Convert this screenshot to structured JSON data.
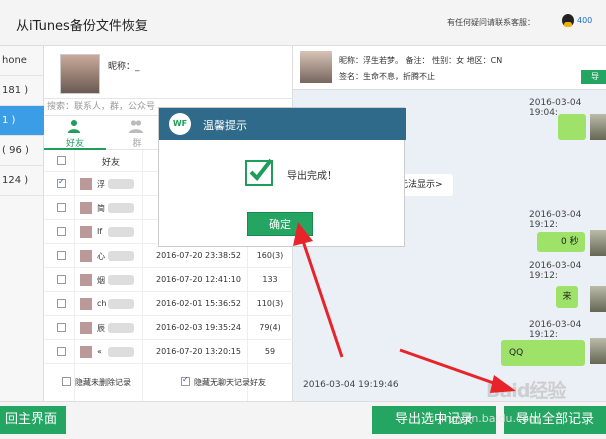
{
  "window": {
    "title": "从iTunes备份文件恢复",
    "help_text": "有任何疑问请联系客服：",
    "help_num": "400"
  },
  "devices": [
    {
      "label": "hone"
    },
    {
      "label": "181 )"
    },
    {
      "label": "1 )"
    },
    {
      "label": "( 96 )"
    },
    {
      "label": "124 )"
    }
  ],
  "account": {
    "nick_label": "昵称：_"
  },
  "search": {
    "placeholder": "搜索：联系人，群，公众号"
  },
  "tabs": {
    "friends": "好友",
    "groups": "群"
  },
  "table": {
    "header_friend": "好友",
    "rows": [
      {
        "name": "浮",
        "date": "",
        "count": "",
        "checked": true
      },
      {
        "name": "简",
        "date": "",
        "count": "",
        "checked": false
      },
      {
        "name": "If",
        "date": "",
        "count": "",
        "checked": false
      },
      {
        "name": "心",
        "date": "2016-07-20 23:38:52",
        "count": "160(3)",
        "checked": false
      },
      {
        "name": "烟",
        "date": "2016-07-20 12:41:10",
        "count": "133",
        "checked": false
      },
      {
        "name": "ch",
        "date": "2016-02-01 15:36:52",
        "count": "110(3)",
        "checked": false
      },
      {
        "name": "辰",
        "date": "2016-02-03 19:35:24",
        "count": "79(4)",
        "checked": false
      },
      {
        "name": "«",
        "date": "2016-07-20 13:20:15",
        "count": "59",
        "checked": false
      }
    ]
  },
  "footer": {
    "hide_deleted": "隐藏未删除记录",
    "hide_no_chat": "隐藏无聊天记录好友"
  },
  "profile": {
    "line1": "昵称：浮生若梦。   备注：             性别：女   地区：CN",
    "line2": "签名：生命不息，折腾不止",
    "button": "导"
  },
  "chat": {
    "ts1": "2016-03-04 19:04:",
    "ts2": "2016-03-04 19:12:",
    "ts3": "2016-03-04 19:12:",
    "ts4": "2016-03-04 19:12:",
    "ts5": "2016-03-04 19:19:46",
    "notice": "无法显示>",
    "voice": "0 秒",
    "msg_lai": "来",
    "msg_q": "QQ"
  },
  "dialog": {
    "logo": "WF",
    "title": "温馨提示",
    "message": "导出完成！",
    "ok": "确定"
  },
  "bottom": {
    "back": "回主界面",
    "export_sel": "导出选中记录",
    "export_all": "导出全部记录"
  },
  "watermark": {
    "brand": "Baid经验",
    "url": "jingyan.baidu.com"
  },
  "colors": {
    "accent": "#24a561",
    "selected": "#3a9de6",
    "header": "#2f6a8a",
    "bubble": "#9ee26a",
    "arrow": "#e8242a"
  }
}
